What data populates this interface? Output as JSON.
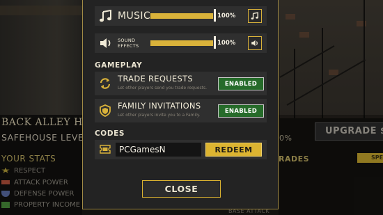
{
  "settings": {
    "audio": {
      "music": {
        "label": "MUSIC",
        "value": "100%",
        "level": 1.0
      },
      "sound_effects": {
        "label_line1": "SOUND",
        "label_line2": "EFFECTS",
        "value": "100%",
        "level": 1.0
      }
    },
    "gameplay": {
      "header": "GAMEPLAY",
      "trade_requests": {
        "title": "TRADE REQUESTS",
        "desc": "Let other players send you trade requests.",
        "status": "ENABLED"
      },
      "family_invitations": {
        "title": "FAMILY INVITATIONS",
        "desc": "Let other players invite you to a Family.",
        "status": "ENABLED"
      }
    },
    "codes": {
      "header": "CODES",
      "value": "PCGamesN",
      "redeem_label": "REDEEM"
    },
    "close_label": "CLOSE"
  },
  "background": {
    "location_title": "BACK ALLEY HIE",
    "level_label": "SAFEHOUSE LEVEL",
    "stats_header": "YOUR STATS",
    "stats": [
      "RESPECT",
      "ATTACK POWER",
      "DEFENSE POWER",
      "PROPERTY INCOME"
    ],
    "upgrade_label": "UPGRADE $",
    "progress_pct": "0%",
    "upgrades_header": "RADES",
    "spec_tag": "SPE",
    "base_attack": "BASE ATTACK"
  },
  "colors": {
    "accent_gold": "#d9b23a",
    "enabled_green": "#266b2a",
    "panel_bg": "#232323",
    "row_bg": "#2f2f2f"
  },
  "icons": {
    "music": "music-note-icon",
    "sound": "speaker-icon",
    "trade": "trade-arrows-icon",
    "family": "shield-icon",
    "code": "ticket-icon"
  }
}
